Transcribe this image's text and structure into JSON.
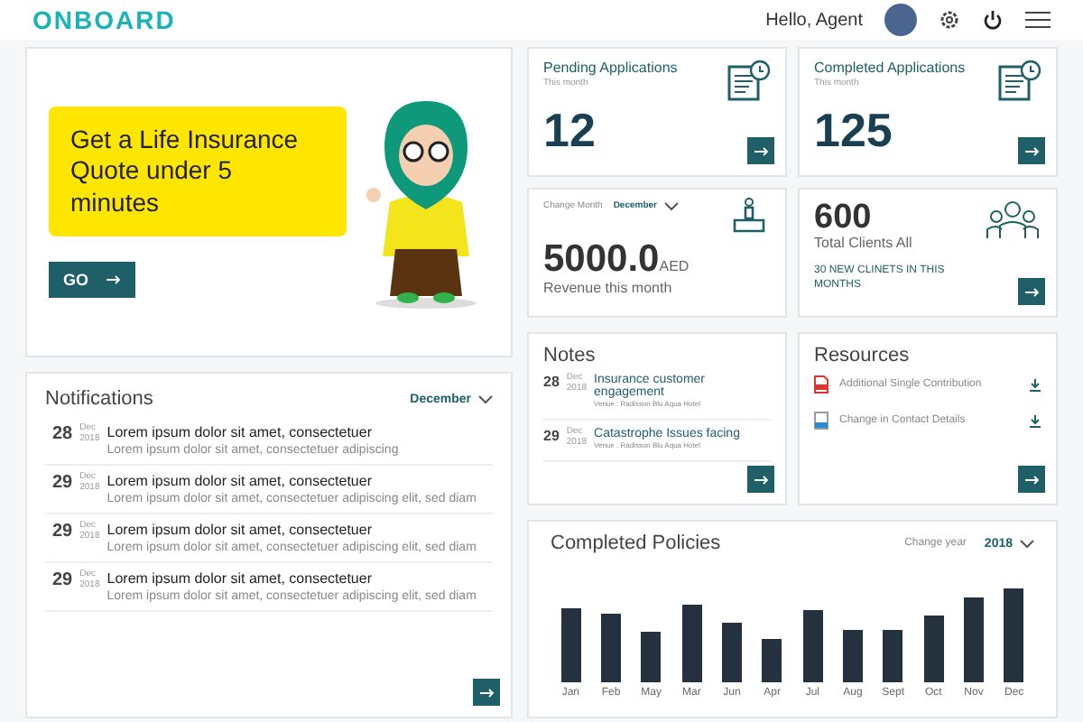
{
  "header": {
    "logo": "ONBOARD",
    "greeting": "Hello, Agent"
  },
  "banner": {
    "quote": "Get a Life Insurance Quote under 5 minutes",
    "button": "GO"
  },
  "stats": [
    {
      "kind": "count",
      "title": "Pending Applications",
      "subtitle": "This month",
      "value": "12"
    },
    {
      "kind": "count",
      "title": "Completed Applications",
      "subtitle": "This month",
      "value": "125"
    },
    {
      "kind": "revenue",
      "change_label": "Change Month",
      "month": "December",
      "value": "5000.0",
      "unit": "AED",
      "caption": "Revenue this month"
    },
    {
      "kind": "clients",
      "value": "600",
      "caption": "Total Clients All",
      "link": "30 NEW CLINETS IN THIS MONTHS"
    }
  ],
  "notifications": {
    "title": "Notifications",
    "month": "December",
    "items": [
      {
        "day": "28",
        "month": "Dec",
        "year": "2018",
        "title": "Lorem ipsum dolor sit amet, consectetuer",
        "text": "Lorem ipsum dolor sit amet, consectetuer adipiscing"
      },
      {
        "day": "29",
        "month": "Dec",
        "year": "2018",
        "title": "Lorem ipsum dolor sit amet, consectetuer",
        "text": "Lorem ipsum dolor sit amet, consectetuer adipiscing elit, sed diam"
      },
      {
        "day": "29",
        "month": "Dec",
        "year": "2018",
        "title": "Lorem ipsum dolor sit amet, consectetuer",
        "text": "Lorem ipsum dolor sit amet, consectetuer adipiscing elit, sed diam"
      },
      {
        "day": "29",
        "month": "Dec",
        "year": "2018",
        "title": "Lorem ipsum dolor sit amet, consectetuer",
        "text": "Lorem ipsum dolor sit amet, consectetuer adipiscing elit, sed diam"
      }
    ]
  },
  "notes": {
    "title": "Notes",
    "items": [
      {
        "day": "28",
        "month": "Dec",
        "year": "2018",
        "title": "Insurance customer engagement",
        "venue": "Venue : Radisson Blu Aqua Hotel"
      },
      {
        "day": "29",
        "month": "Dec",
        "year": "2018",
        "title": "Catastrophe Issues facing",
        "venue": "Venue : Radisson Blu Aqua Hotel"
      }
    ]
  },
  "resources": {
    "title": "Resources",
    "items": [
      {
        "kind": "pdf",
        "name": "Additional Single Contribution"
      },
      {
        "kind": "doc",
        "name": "Change in Contact Details"
      }
    ]
  },
  "policies": {
    "title": "Completed Policies",
    "change_label": "Change year",
    "year": "2018",
    "months": [
      "Jan",
      "Feb",
      "May",
      "Mar",
      "Jun",
      "Apr",
      "Jul",
      "Aug",
      "Sept",
      "Oct",
      "Nov",
      "Dec"
    ]
  }
}
